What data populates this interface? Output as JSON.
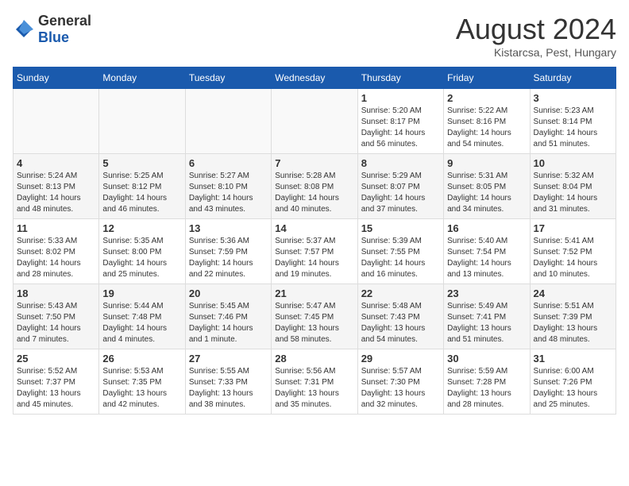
{
  "header": {
    "logo_general": "General",
    "logo_blue": "Blue",
    "month_title": "August 2024",
    "location": "Kistarcsa, Pest, Hungary"
  },
  "days_of_week": [
    "Sunday",
    "Monday",
    "Tuesday",
    "Wednesday",
    "Thursday",
    "Friday",
    "Saturday"
  ],
  "weeks": [
    [
      {
        "day": "",
        "sunrise": "",
        "sunset": "",
        "daylight": ""
      },
      {
        "day": "",
        "sunrise": "",
        "sunset": "",
        "daylight": ""
      },
      {
        "day": "",
        "sunrise": "",
        "sunset": "",
        "daylight": ""
      },
      {
        "day": "",
        "sunrise": "",
        "sunset": "",
        "daylight": ""
      },
      {
        "day": "1",
        "sunrise": "Sunrise: 5:20 AM",
        "sunset": "Sunset: 8:17 PM",
        "daylight": "Daylight: 14 hours and 56 minutes."
      },
      {
        "day": "2",
        "sunrise": "Sunrise: 5:22 AM",
        "sunset": "Sunset: 8:16 PM",
        "daylight": "Daylight: 14 hours and 54 minutes."
      },
      {
        "day": "3",
        "sunrise": "Sunrise: 5:23 AM",
        "sunset": "Sunset: 8:14 PM",
        "daylight": "Daylight: 14 hours and 51 minutes."
      }
    ],
    [
      {
        "day": "4",
        "sunrise": "Sunrise: 5:24 AM",
        "sunset": "Sunset: 8:13 PM",
        "daylight": "Daylight: 14 hours and 48 minutes."
      },
      {
        "day": "5",
        "sunrise": "Sunrise: 5:25 AM",
        "sunset": "Sunset: 8:12 PM",
        "daylight": "Daylight: 14 hours and 46 minutes."
      },
      {
        "day": "6",
        "sunrise": "Sunrise: 5:27 AM",
        "sunset": "Sunset: 8:10 PM",
        "daylight": "Daylight: 14 hours and 43 minutes."
      },
      {
        "day": "7",
        "sunrise": "Sunrise: 5:28 AM",
        "sunset": "Sunset: 8:08 PM",
        "daylight": "Daylight: 14 hours and 40 minutes."
      },
      {
        "day": "8",
        "sunrise": "Sunrise: 5:29 AM",
        "sunset": "Sunset: 8:07 PM",
        "daylight": "Daylight: 14 hours and 37 minutes."
      },
      {
        "day": "9",
        "sunrise": "Sunrise: 5:31 AM",
        "sunset": "Sunset: 8:05 PM",
        "daylight": "Daylight: 14 hours and 34 minutes."
      },
      {
        "day": "10",
        "sunrise": "Sunrise: 5:32 AM",
        "sunset": "Sunset: 8:04 PM",
        "daylight": "Daylight: 14 hours and 31 minutes."
      }
    ],
    [
      {
        "day": "11",
        "sunrise": "Sunrise: 5:33 AM",
        "sunset": "Sunset: 8:02 PM",
        "daylight": "Daylight: 14 hours and 28 minutes."
      },
      {
        "day": "12",
        "sunrise": "Sunrise: 5:35 AM",
        "sunset": "Sunset: 8:00 PM",
        "daylight": "Daylight: 14 hours and 25 minutes."
      },
      {
        "day": "13",
        "sunrise": "Sunrise: 5:36 AM",
        "sunset": "Sunset: 7:59 PM",
        "daylight": "Daylight: 14 hours and 22 minutes."
      },
      {
        "day": "14",
        "sunrise": "Sunrise: 5:37 AM",
        "sunset": "Sunset: 7:57 PM",
        "daylight": "Daylight: 14 hours and 19 minutes."
      },
      {
        "day": "15",
        "sunrise": "Sunrise: 5:39 AM",
        "sunset": "Sunset: 7:55 PM",
        "daylight": "Daylight: 14 hours and 16 minutes."
      },
      {
        "day": "16",
        "sunrise": "Sunrise: 5:40 AM",
        "sunset": "Sunset: 7:54 PM",
        "daylight": "Daylight: 14 hours and 13 minutes."
      },
      {
        "day": "17",
        "sunrise": "Sunrise: 5:41 AM",
        "sunset": "Sunset: 7:52 PM",
        "daylight": "Daylight: 14 hours and 10 minutes."
      }
    ],
    [
      {
        "day": "18",
        "sunrise": "Sunrise: 5:43 AM",
        "sunset": "Sunset: 7:50 PM",
        "daylight": "Daylight: 14 hours and 7 minutes."
      },
      {
        "day": "19",
        "sunrise": "Sunrise: 5:44 AM",
        "sunset": "Sunset: 7:48 PM",
        "daylight": "Daylight: 14 hours and 4 minutes."
      },
      {
        "day": "20",
        "sunrise": "Sunrise: 5:45 AM",
        "sunset": "Sunset: 7:46 PM",
        "daylight": "Daylight: 14 hours and 1 minute."
      },
      {
        "day": "21",
        "sunrise": "Sunrise: 5:47 AM",
        "sunset": "Sunset: 7:45 PM",
        "daylight": "Daylight: 13 hours and 58 minutes."
      },
      {
        "day": "22",
        "sunrise": "Sunrise: 5:48 AM",
        "sunset": "Sunset: 7:43 PM",
        "daylight": "Daylight: 13 hours and 54 minutes."
      },
      {
        "day": "23",
        "sunrise": "Sunrise: 5:49 AM",
        "sunset": "Sunset: 7:41 PM",
        "daylight": "Daylight: 13 hours and 51 minutes."
      },
      {
        "day": "24",
        "sunrise": "Sunrise: 5:51 AM",
        "sunset": "Sunset: 7:39 PM",
        "daylight": "Daylight: 13 hours and 48 minutes."
      }
    ],
    [
      {
        "day": "25",
        "sunrise": "Sunrise: 5:52 AM",
        "sunset": "Sunset: 7:37 PM",
        "daylight": "Daylight: 13 hours and 45 minutes."
      },
      {
        "day": "26",
        "sunrise": "Sunrise: 5:53 AM",
        "sunset": "Sunset: 7:35 PM",
        "daylight": "Daylight: 13 hours and 42 minutes."
      },
      {
        "day": "27",
        "sunrise": "Sunrise: 5:55 AM",
        "sunset": "Sunset: 7:33 PM",
        "daylight": "Daylight: 13 hours and 38 minutes."
      },
      {
        "day": "28",
        "sunrise": "Sunrise: 5:56 AM",
        "sunset": "Sunset: 7:31 PM",
        "daylight": "Daylight: 13 hours and 35 minutes."
      },
      {
        "day": "29",
        "sunrise": "Sunrise: 5:57 AM",
        "sunset": "Sunset: 7:30 PM",
        "daylight": "Daylight: 13 hours and 32 minutes."
      },
      {
        "day": "30",
        "sunrise": "Sunrise: 5:59 AM",
        "sunset": "Sunset: 7:28 PM",
        "daylight": "Daylight: 13 hours and 28 minutes."
      },
      {
        "day": "31",
        "sunrise": "Sunrise: 6:00 AM",
        "sunset": "Sunset: 7:26 PM",
        "daylight": "Daylight: 13 hours and 25 minutes."
      }
    ]
  ]
}
